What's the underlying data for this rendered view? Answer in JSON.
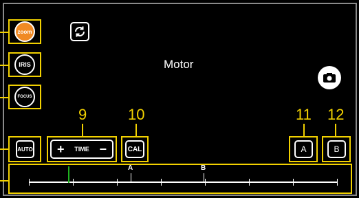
{
  "title": "Motor",
  "side_buttons": [
    {
      "label": "zoom",
      "active": true
    },
    {
      "label": "IRIS",
      "active": false
    },
    {
      "label": "FOCUS",
      "active": false
    }
  ],
  "auto_label": "AUTO",
  "time": {
    "minus": "−",
    "label": "TIME",
    "plus": "+"
  },
  "cal_label": "CAL",
  "a_label": "A",
  "b_label": "B",
  "callouts": {
    "n9": "9",
    "n10": "10",
    "n11": "11",
    "n12": "12"
  },
  "slider": {
    "marker_a": "A",
    "marker_b": "B"
  },
  "icons": {
    "refresh": "refresh-icon",
    "camera": "camera-icon"
  },
  "colors": {
    "accent": "#f2d100",
    "active": "#f08a24",
    "indicator": "#1fb31f"
  }
}
